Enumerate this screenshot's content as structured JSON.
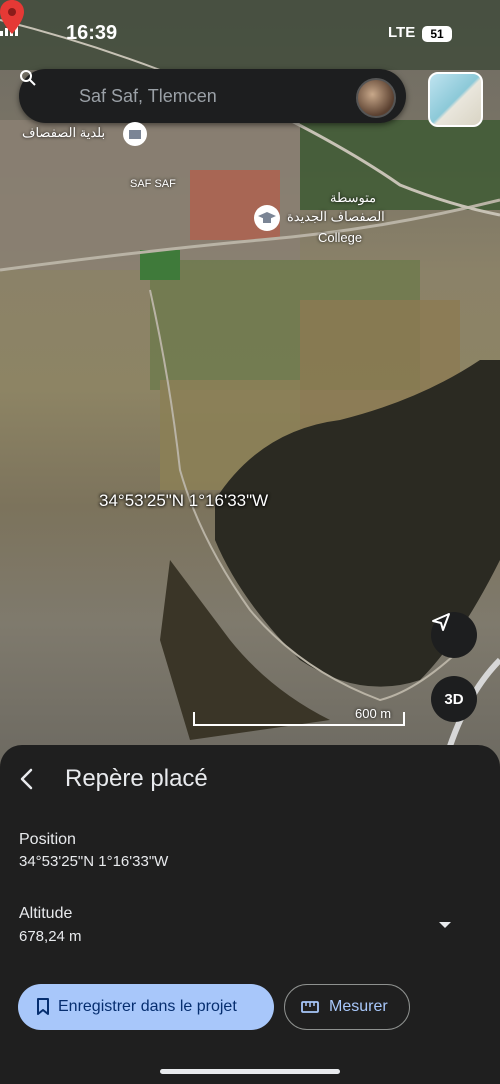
{
  "status_bar": {
    "time": "16:39",
    "network": "LTE",
    "battery": "51"
  },
  "search": {
    "query": "Saf Saf, Tlemcen"
  },
  "map": {
    "poi_labels": [
      "بلدية الصفصاف",
      "SAF SAF",
      "متوسطة",
      "الصفصاف الجديدة",
      "College"
    ],
    "pin_coordinates": "34°53'25\"N 1°16'33\"W",
    "scale_label": "600 m",
    "view_3d_label": "3D"
  },
  "sheet": {
    "title": "Repère placé",
    "position_label": "Position",
    "position_value": "34°53'25\"N 1°16'33\"W",
    "altitude_label": "Altitude",
    "altitude_value": "678,24 m",
    "save_button": "Enregistrer dans le projet",
    "measure_button": "Mesurer"
  },
  "colors": {
    "accent": "#a8c7fa",
    "sheet_bg": "#1f1f1f",
    "pin": "#e53935"
  }
}
